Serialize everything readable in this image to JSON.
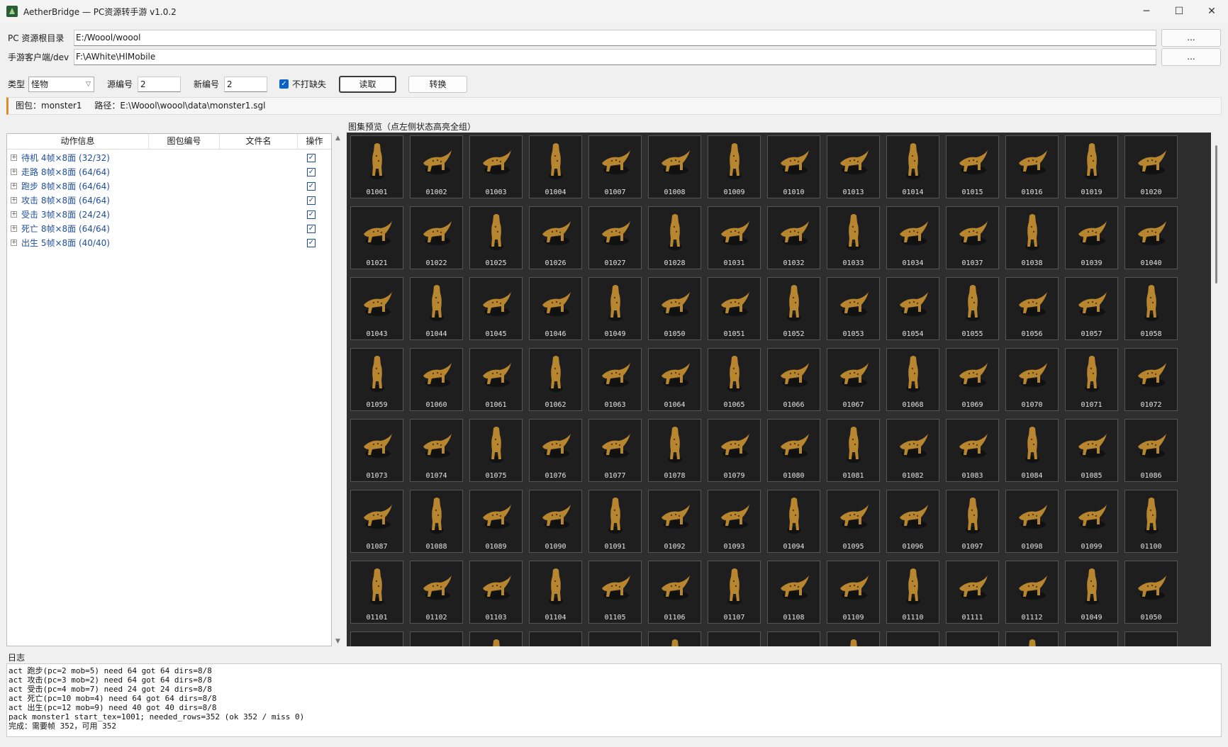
{
  "window": {
    "title": "AetherBridge — PC资源转手游  v1.0.2",
    "controls": [
      "─",
      "☐",
      "✕"
    ]
  },
  "paths": {
    "pc_label": "PC 资源根目录",
    "pc_value": "E:/Woool/woool",
    "mobile_label": "手游客户端/dev",
    "mobile_value": "F:\\AWhite\\HlMobile",
    "browse_label": "..."
  },
  "options": {
    "type_label": "类型",
    "type_value": "怪物",
    "src_label": "源编号",
    "src_value": "2",
    "new_label": "新编号",
    "new_value": "2",
    "missing_label": "不打缺失",
    "missing_checked": true,
    "read_button": "读取",
    "convert_button": "转换"
  },
  "info": {
    "pack": "图包：monster1",
    "path": "路径：E:\\Woool\\woool\\data\\monster1.sgl"
  },
  "preview_title": "图集预览（点左侧状态高亮全组）",
  "tree": {
    "headers": [
      "动作信息",
      "图包编号",
      "文件名",
      "操作"
    ],
    "rows": [
      {
        "label": "待机   4帧×8面 (32/32)"
      },
      {
        "label": "走路   8帧×8面 (64/64)"
      },
      {
        "label": "跑步   8帧×8面 (64/64)"
      },
      {
        "label": "攻击   8帧×8面 (64/64)"
      },
      {
        "label": "受击   3帧×8面 (24/24)"
      },
      {
        "label": "死亡   8帧×8面 (64/64)"
      },
      {
        "label": "出生   5帧×8面 (40/40)"
      }
    ]
  },
  "thumbnails": [
    [
      "01001",
      "01002",
      "01003",
      "01004",
      "01007",
      "01008",
      "01009",
      "01010",
      "01013",
      "01014",
      "01015",
      "01016",
      "01019",
      "01020"
    ],
    [
      "01021",
      "01022",
      "01025",
      "01026",
      "01027",
      "01028",
      "01031",
      "01032",
      "01033",
      "01034",
      "01037",
      "01038",
      "01039",
      "01040"
    ],
    [
      "01043",
      "01044",
      "01045",
      "01046",
      "01049",
      "01050",
      "01051",
      "01052",
      "01053",
      "01054",
      "01055",
      "01056",
      "01057",
      "01058"
    ],
    [
      "01059",
      "01060",
      "01061",
      "01062",
      "01063",
      "01064",
      "01065",
      "01066",
      "01067",
      "01068",
      "01069",
      "01070",
      "01071",
      "01072"
    ],
    [
      "01073",
      "01074",
      "01075",
      "01076",
      "01077",
      "01078",
      "01079",
      "01080",
      "01081",
      "01082",
      "01083",
      "01084",
      "01085",
      "01086"
    ],
    [
      "01087",
      "01088",
      "01089",
      "01090",
      "01091",
      "01092",
      "01093",
      "01094",
      "01095",
      "01096",
      "01097",
      "01098",
      "01099",
      "01100"
    ],
    [
      "01101",
      "01102",
      "01103",
      "01104",
      "01105",
      "01106",
      "01107",
      "01108",
      "01109",
      "01110",
      "01111",
      "01112",
      "01049",
      "01050"
    ],
    [
      "",
      "",
      "",
      "",
      "",
      "",
      "",
      "",
      "",
      "",
      "",
      "",
      "",
      ""
    ]
  ],
  "log": {
    "title": "日志",
    "lines": [
      "act 跑步(pc=2 mob=5) need 64 got 64 dirs=8/8",
      "act 攻击(pc=3 mob=2) need 64 got 64 dirs=8/8",
      "act 受击(pc=4 mob=7) need 24 got 24 dirs=8/8",
      "act 死亡(pc=10 mob=4) need 64 got 64 dirs=8/8",
      "act 出生(pc=12 mob=9) need 40 got 40 dirs=8/8",
      "pack monster1 start_tex=1001; needed_rows=352 (ok 352 / miss 0)",
      "完成：需要帧 352，可用 352"
    ]
  }
}
